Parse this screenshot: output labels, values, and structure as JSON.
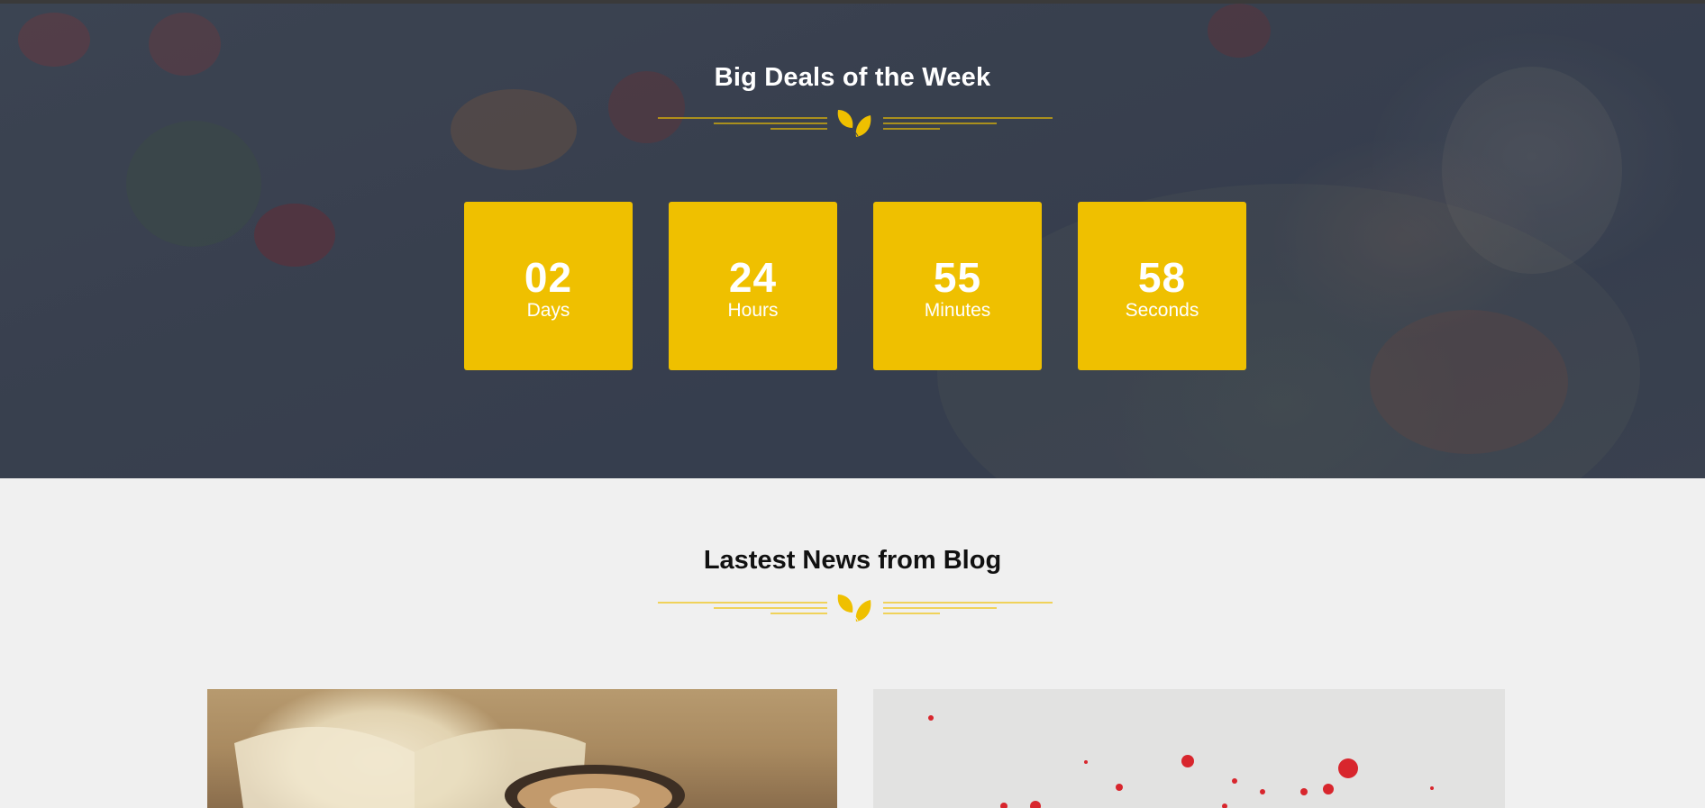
{
  "deals": {
    "title": "Big Deals of the Week",
    "countdown": [
      {
        "value": "02",
        "label": "Days"
      },
      {
        "value": "24",
        "label": "Hours"
      },
      {
        "value": "55",
        "label": "Minutes"
      },
      {
        "value": "58",
        "label": "Seconds"
      }
    ]
  },
  "blog": {
    "title": "Lastest News from Blog"
  },
  "colors": {
    "accent": "#efc000",
    "hero_overlay": "#3f4756",
    "page_bg": "#f0f0f0"
  },
  "icons": {
    "divider": "leaf-icon"
  }
}
